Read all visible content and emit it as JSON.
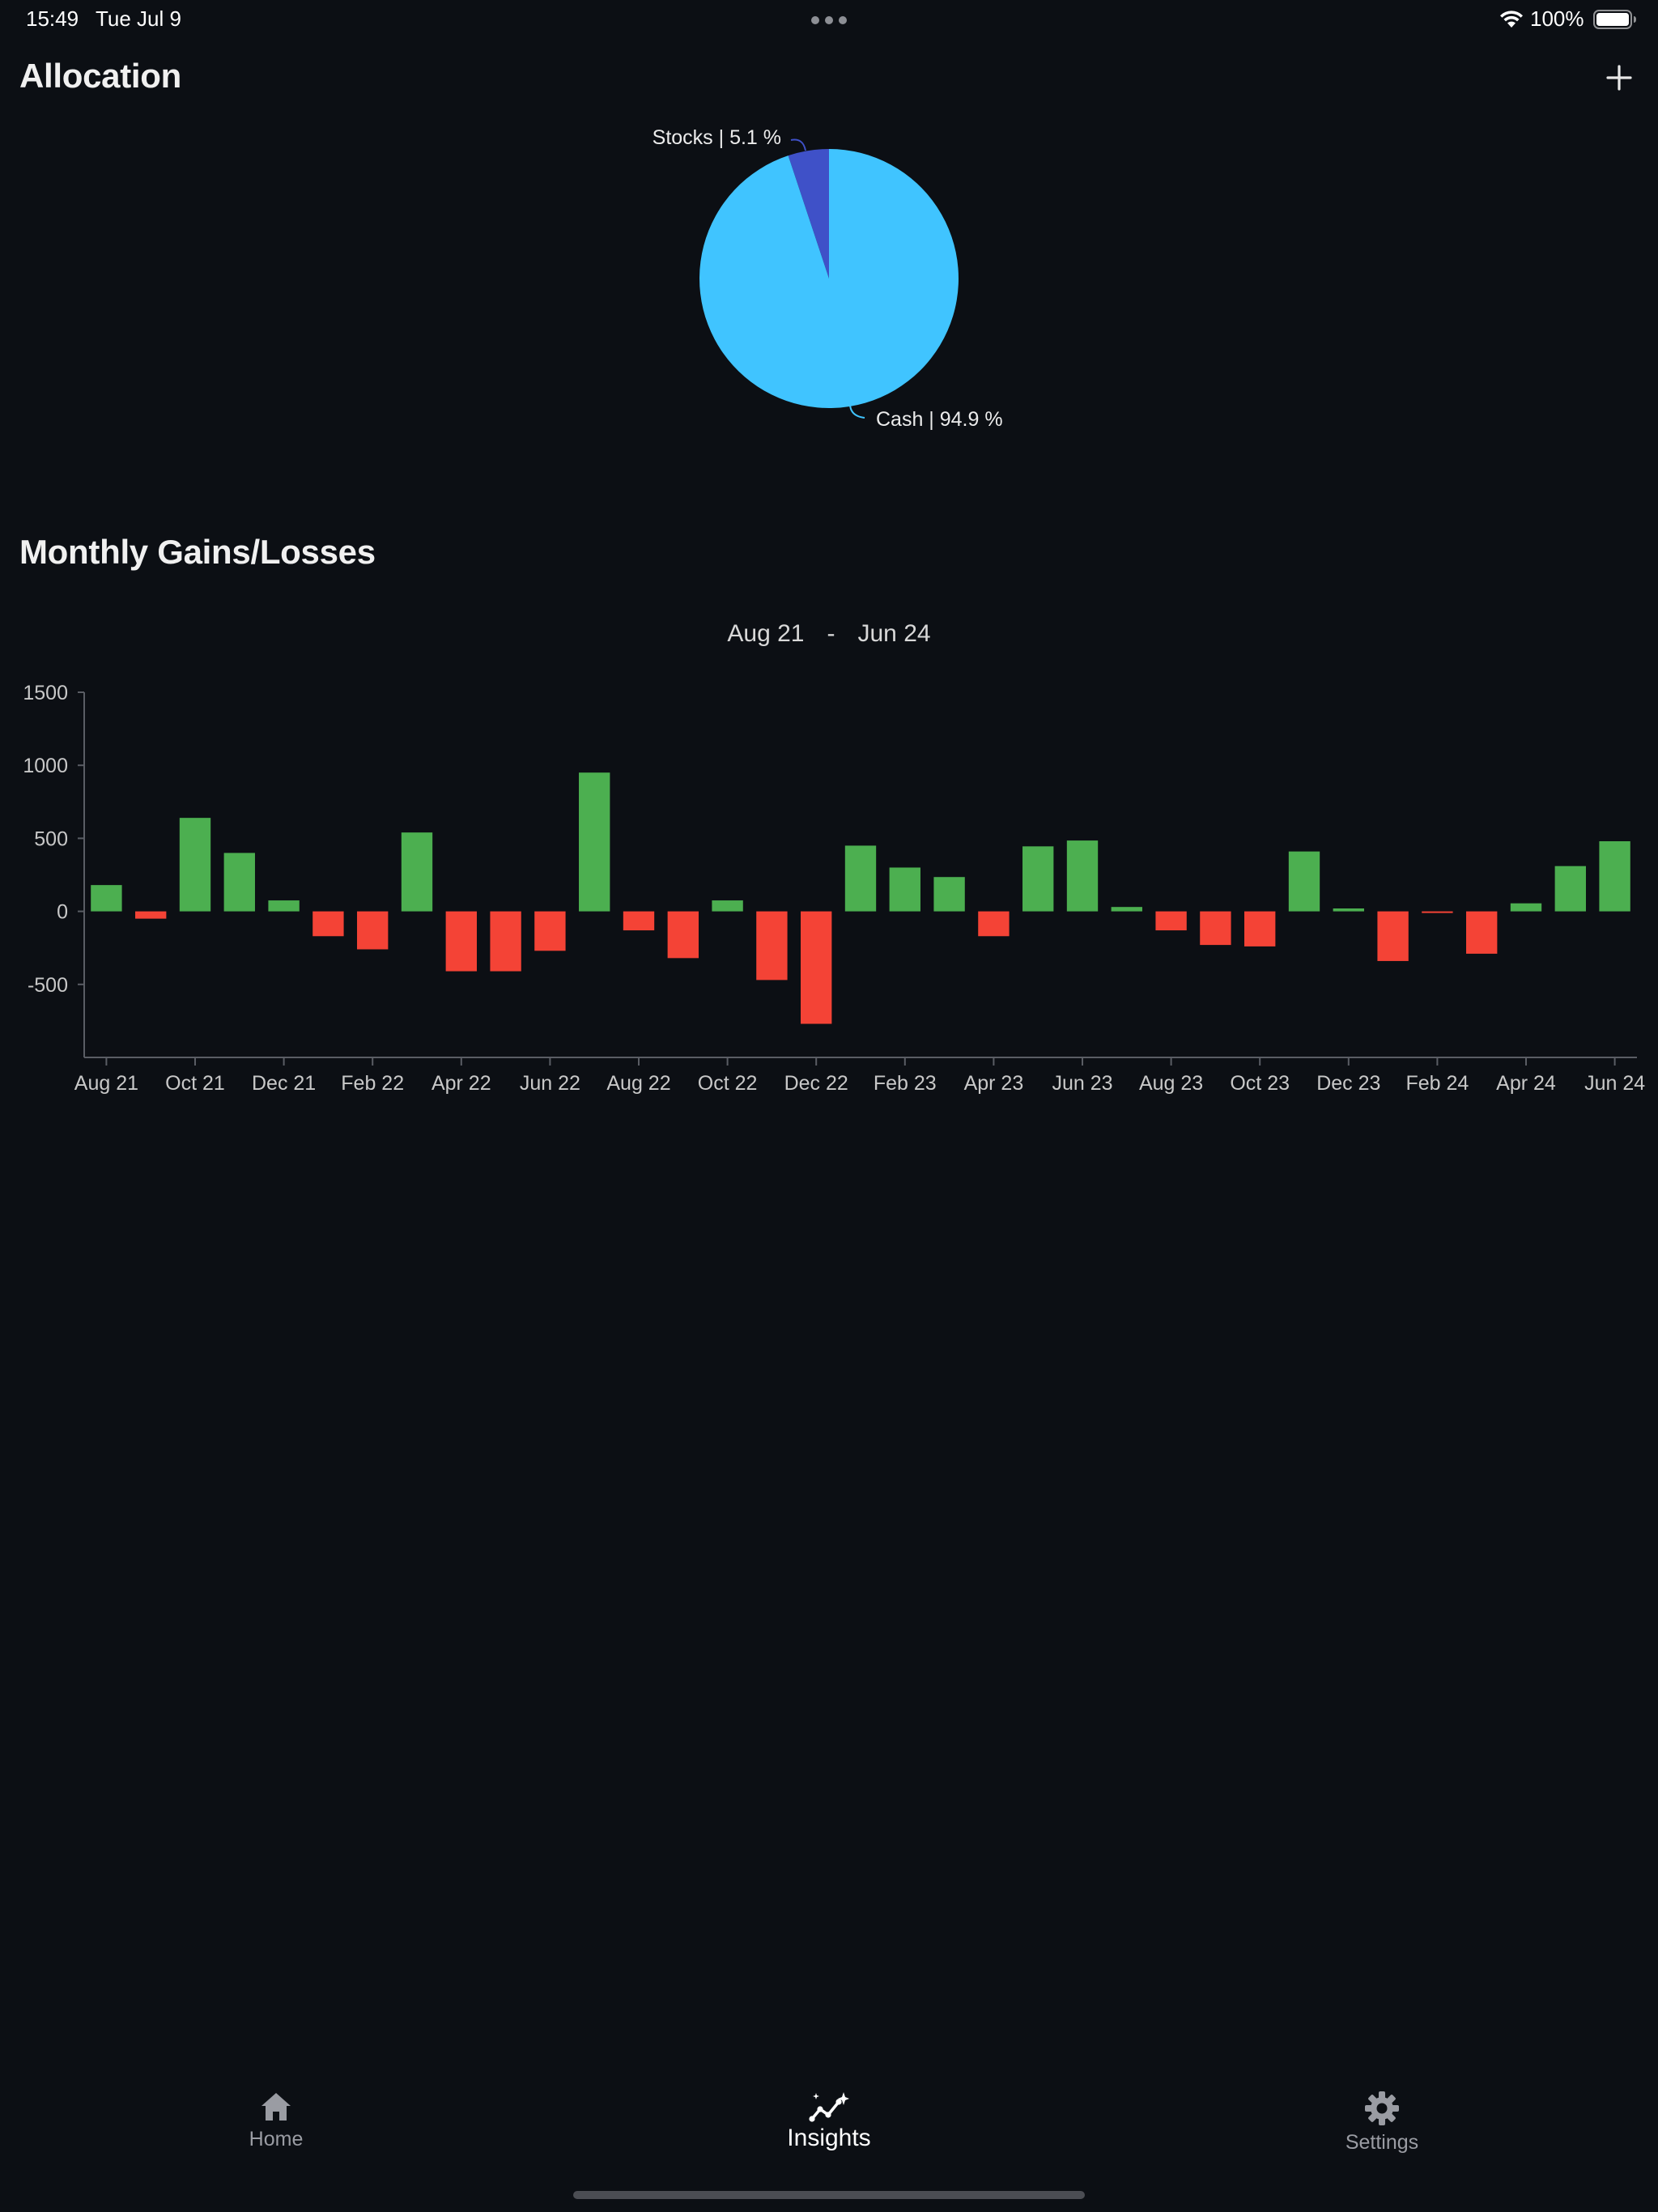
{
  "status_bar": {
    "time": "15:49",
    "date": "Tue Jul 9",
    "battery": "100%"
  },
  "allocation": {
    "title": "Allocation",
    "add_icon": "plus-icon",
    "chart_data": {
      "type": "pie",
      "slices": [
        {
          "label": "Stocks | 5.1 %",
          "value": 5.1,
          "color": "#3f51c8"
        },
        {
          "label": "Cash | 94.9 %",
          "value": 94.9,
          "color": "#40c4ff"
        }
      ]
    }
  },
  "gains": {
    "title": "Monthly Gains/Losses",
    "range_start": "Aug 21",
    "range_sep": "-",
    "range_end": "Jun 24",
    "chart_data": {
      "type": "bar",
      "positive_color": "#4caf50",
      "negative_color": "#f44336",
      "ylim": [
        -1000,
        1500
      ],
      "yticks": [
        1500,
        1000,
        500,
        0,
        -500
      ],
      "x_tick_labels": [
        "Aug 21",
        "Oct 21",
        "Dec 21",
        "Feb 22",
        "Apr 22",
        "Jun 22",
        "Aug 22",
        "Oct 22",
        "Dec 22",
        "Feb 23",
        "Apr 23",
        "Jun 23",
        "Aug 23",
        "Oct 23",
        "Dec 23",
        "Feb 24",
        "Apr 24",
        "Jun 24"
      ],
      "categories": [
        "Aug 21",
        "Sep 21",
        "Oct 21",
        "Nov 21",
        "Dec 21",
        "Jan 22",
        "Feb 22",
        "Mar 22",
        "Apr 22",
        "May 22",
        "Jun 22",
        "Jul 22",
        "Aug 22",
        "Sep 22",
        "Oct 22",
        "Nov 22",
        "Dec 22",
        "Jan 23",
        "Feb 23",
        "Mar 23",
        "Apr 23",
        "May 23",
        "Jun 23",
        "Jul 23",
        "Aug 23",
        "Sep 23",
        "Oct 23",
        "Nov 23",
        "Dec 23",
        "Jan 24",
        "Feb 24",
        "Mar 24",
        "Apr 24",
        "May 24",
        "Jun 24"
      ],
      "values": [
        180,
        -50,
        640,
        400,
        75,
        -170,
        -260,
        540,
        -410,
        -410,
        -270,
        950,
        -130,
        -320,
        75,
        -470,
        -770,
        450,
        300,
        235,
        -170,
        445,
        485,
        30,
        -130,
        -230,
        -240,
        410,
        20,
        -340,
        -10,
        -290,
        55,
        310,
        480
      ]
    }
  },
  "tabs": [
    {
      "label": "Home",
      "icon": "home-icon",
      "active": false
    },
    {
      "label": "Insights",
      "icon": "insights-icon",
      "active": true
    },
    {
      "label": "Settings",
      "icon": "gear-icon",
      "active": false
    }
  ]
}
